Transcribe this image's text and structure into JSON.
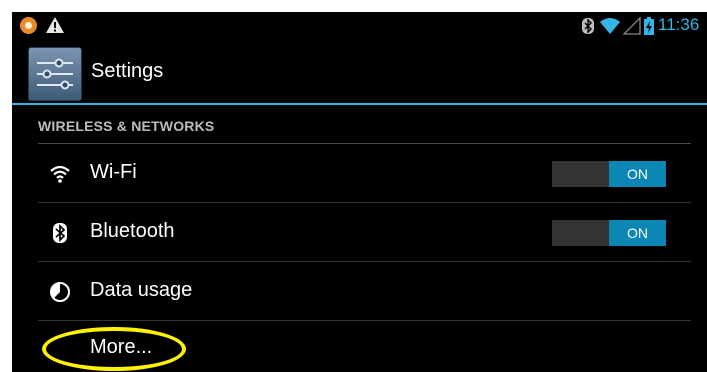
{
  "status_bar": {
    "time": "11:36",
    "icons": [
      "app-notification-icon",
      "warning-icon",
      "bluetooth-icon",
      "wifi-icon",
      "signal-icon",
      "battery-charging-icon"
    ]
  },
  "action_bar": {
    "title": "Settings",
    "icon": "settings-sliders-icon",
    "accent_color": "#33b5e5"
  },
  "section": {
    "header": "WIRELESS & NETWORKS"
  },
  "items": [
    {
      "label": "Wi-Fi",
      "icon": "wifi-icon",
      "toggle": "ON"
    },
    {
      "label": "Bluetooth",
      "icon": "bluetooth-icon",
      "toggle": "ON"
    },
    {
      "label": "Data usage",
      "icon": "data-usage-icon"
    },
    {
      "label": "More...",
      "highlight_color": "#fff200"
    }
  ],
  "colors": {
    "background": "#000000",
    "toggle_on": "#0b86b5",
    "toggle_off": "#333333",
    "text_primary": "#ffffff",
    "text_section": "#bdbdbd"
  }
}
